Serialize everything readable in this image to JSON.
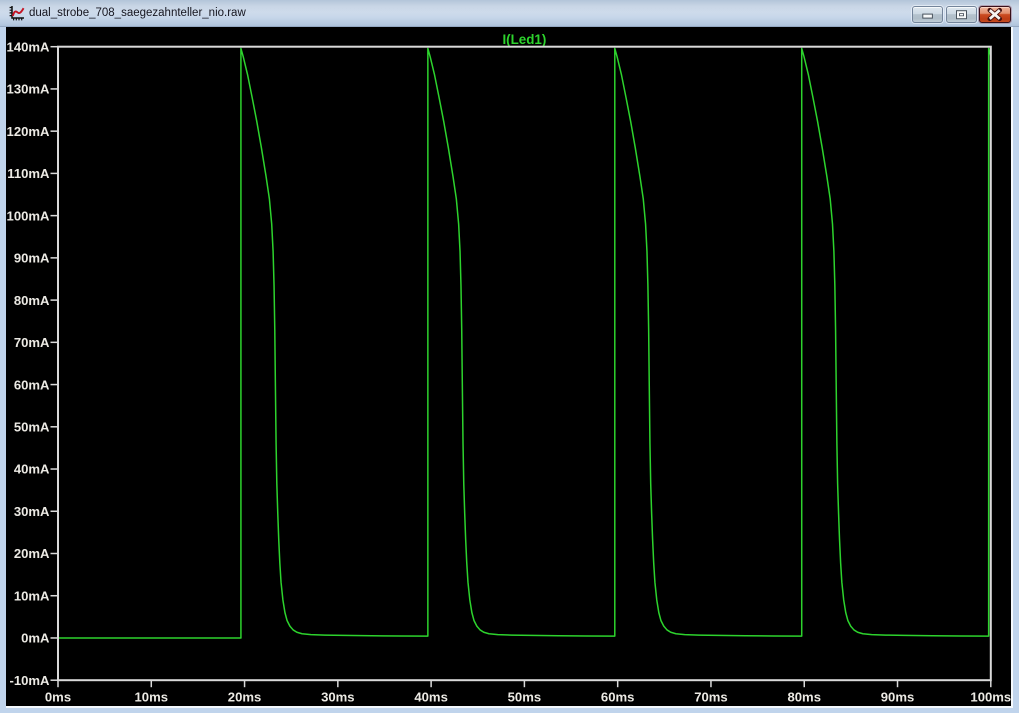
{
  "window": {
    "title": "dual_strobe_708_saegezahnteller_nio.raw",
    "app_icon": "waveform-plot-icon",
    "controls": {
      "minimize": "Minimize",
      "maximize": "Maximize",
      "close": "Close"
    }
  },
  "colors": {
    "frame_blue": "#c0d4ec",
    "plot_background": "#000000",
    "axis_gray": "#dadada",
    "label_white": "#eceae4",
    "trace_green": "#2dd32d",
    "close_red": "#c84020"
  },
  "chart_data": {
    "type": "line",
    "title": "I(Led1)",
    "x_unit": "ms",
    "y_unit": "mA",
    "xlim": [
      0,
      100
    ],
    "ylim": [
      -10,
      140
    ],
    "grid": false,
    "legend_position": "top-center",
    "x_ticks": [
      {
        "value": 0,
        "label": "0ms"
      },
      {
        "value": 10,
        "label": "10ms"
      },
      {
        "value": 20,
        "label": "20ms"
      },
      {
        "value": 30,
        "label": "30ms"
      },
      {
        "value": 40,
        "label": "40ms"
      },
      {
        "value": 50,
        "label": "50ms"
      },
      {
        "value": 60,
        "label": "60ms"
      },
      {
        "value": 70,
        "label": "70ms"
      },
      {
        "value": 80,
        "label": "80ms"
      },
      {
        "value": 90,
        "label": "90ms"
      },
      {
        "value": 100,
        "label": "100ms"
      }
    ],
    "y_ticks": [
      {
        "value": -10,
        "label": "-10mA"
      },
      {
        "value": 0,
        "label": "0mA"
      },
      {
        "value": 10,
        "label": "10mA"
      },
      {
        "value": 20,
        "label": "20mA"
      },
      {
        "value": 30,
        "label": "30mA"
      },
      {
        "value": 40,
        "label": "40mA"
      },
      {
        "value": 50,
        "label": "50mA"
      },
      {
        "value": 60,
        "label": "60mA"
      },
      {
        "value": 70,
        "label": "70mA"
      },
      {
        "value": 80,
        "label": "80mA"
      },
      {
        "value": 90,
        "label": "90mA"
      },
      {
        "value": 100,
        "label": "100mA"
      },
      {
        "value": 110,
        "label": "110mA"
      },
      {
        "value": 120,
        "label": "120mA"
      },
      {
        "value": 130,
        "label": "130mA"
      },
      {
        "value": 140,
        "label": "140mA"
      }
    ],
    "series": [
      {
        "name": "I(Led1)",
        "color": "#2dd32d",
        "pulse_period_ms": 20.04,
        "first_pulse_rise_ms": 19.61,
        "peak_ma": 139.6,
        "points": [
          [
            0,
            0
          ],
          [
            19.61,
            0
          ],
          [
            19.61,
            139.6
          ],
          [
            19.86,
            137.6
          ],
          [
            20.31,
            133.5
          ],
          [
            20.81,
            128.0
          ],
          [
            21.31,
            122.3
          ],
          [
            21.81,
            116.0
          ],
          [
            22.31,
            109.2
          ],
          [
            22.66,
            104.0
          ],
          [
            22.91,
            98.0
          ],
          [
            23.06,
            91.5
          ],
          [
            23.16,
            83.5
          ],
          [
            23.24,
            73.0
          ],
          [
            23.31,
            59.0
          ],
          [
            23.38,
            46.0
          ],
          [
            23.46,
            36.5
          ],
          [
            23.56,
            29.5
          ],
          [
            23.66,
            23.5
          ],
          [
            23.78,
            17.8
          ],
          [
            23.91,
            13.2
          ],
          [
            24.11,
            9.0
          ],
          [
            24.33,
            6.0
          ],
          [
            24.56,
            4.1
          ],
          [
            24.86,
            2.8
          ],
          [
            25.21,
            1.9
          ],
          [
            25.61,
            1.35
          ],
          [
            26.16,
            1.0
          ],
          [
            27.11,
            0.8
          ],
          [
            28.61,
            0.68
          ],
          [
            30.61,
            0.6
          ],
          [
            33.61,
            0.52
          ],
          [
            36.61,
            0.47
          ],
          [
            39.65,
            0.44
          ],
          [
            39.65,
            139.6
          ],
          [
            39.9,
            137.6
          ],
          [
            40.35,
            133.5
          ],
          [
            40.85,
            128.0
          ],
          [
            41.35,
            122.3
          ],
          [
            41.85,
            116.0
          ],
          [
            42.35,
            109.2
          ],
          [
            42.7,
            104.0
          ],
          [
            42.95,
            98.0
          ],
          [
            43.1,
            91.5
          ],
          [
            43.2,
            83.5
          ],
          [
            43.28,
            73.0
          ],
          [
            43.35,
            59.0
          ],
          [
            43.42,
            46.0
          ],
          [
            43.5,
            36.5
          ],
          [
            43.6,
            29.5
          ],
          [
            43.7,
            23.5
          ],
          [
            43.82,
            17.8
          ],
          [
            43.95,
            13.2
          ],
          [
            44.15,
            9.0
          ],
          [
            44.37,
            6.0
          ],
          [
            44.6,
            4.1
          ],
          [
            44.9,
            2.8
          ],
          [
            45.25,
            1.9
          ],
          [
            45.65,
            1.35
          ],
          [
            46.2,
            1.0
          ],
          [
            47.15,
            0.8
          ],
          [
            48.65,
            0.68
          ],
          [
            50.65,
            0.6
          ],
          [
            53.65,
            0.52
          ],
          [
            56.65,
            0.47
          ],
          [
            59.69,
            0.44
          ],
          [
            59.69,
            139.6
          ],
          [
            59.94,
            137.6
          ],
          [
            60.39,
            133.5
          ],
          [
            60.89,
            128.0
          ],
          [
            61.39,
            122.3
          ],
          [
            61.89,
            116.0
          ],
          [
            62.39,
            109.2
          ],
          [
            62.74,
            104.0
          ],
          [
            62.99,
            98.0
          ],
          [
            63.14,
            91.5
          ],
          [
            63.24,
            83.5
          ],
          [
            63.32,
            73.0
          ],
          [
            63.39,
            59.0
          ],
          [
            63.46,
            46.0
          ],
          [
            63.54,
            36.5
          ],
          [
            63.64,
            29.5
          ],
          [
            63.74,
            23.5
          ],
          [
            63.86,
            17.8
          ],
          [
            63.99,
            13.2
          ],
          [
            64.19,
            9.0
          ],
          [
            64.41,
            6.0
          ],
          [
            64.64,
            4.1
          ],
          [
            64.94,
            2.8
          ],
          [
            65.29,
            1.9
          ],
          [
            65.69,
            1.35
          ],
          [
            66.24,
            1.0
          ],
          [
            67.19,
            0.8
          ],
          [
            68.69,
            0.68
          ],
          [
            70.69,
            0.6
          ],
          [
            73.69,
            0.52
          ],
          [
            76.69,
            0.47
          ],
          [
            79.73,
            0.44
          ],
          [
            79.73,
            139.6
          ],
          [
            79.98,
            137.6
          ],
          [
            80.43,
            133.5
          ],
          [
            80.93,
            128.0
          ],
          [
            81.43,
            122.3
          ],
          [
            81.93,
            116.0
          ],
          [
            82.43,
            109.2
          ],
          [
            82.78,
            104.0
          ],
          [
            83.03,
            98.0
          ],
          [
            83.18,
            91.5
          ],
          [
            83.28,
            83.5
          ],
          [
            83.36,
            73.0
          ],
          [
            83.43,
            59.0
          ],
          [
            83.5,
            46.0
          ],
          [
            83.58,
            36.5
          ],
          [
            83.68,
            29.5
          ],
          [
            83.78,
            23.5
          ],
          [
            83.9,
            17.8
          ],
          [
            84.03,
            13.2
          ],
          [
            84.23,
            9.0
          ],
          [
            84.45,
            6.0
          ],
          [
            84.68,
            4.1
          ],
          [
            84.98,
            2.8
          ],
          [
            85.33,
            1.9
          ],
          [
            85.73,
            1.35
          ],
          [
            86.28,
            1.0
          ],
          [
            87.23,
            0.8
          ],
          [
            88.73,
            0.68
          ],
          [
            90.73,
            0.6
          ],
          [
            93.73,
            0.52
          ],
          [
            96.73,
            0.47
          ],
          [
            99.77,
            0.44
          ],
          [
            99.77,
            139.6
          ],
          [
            100.0,
            137.8
          ]
        ]
      }
    ]
  }
}
